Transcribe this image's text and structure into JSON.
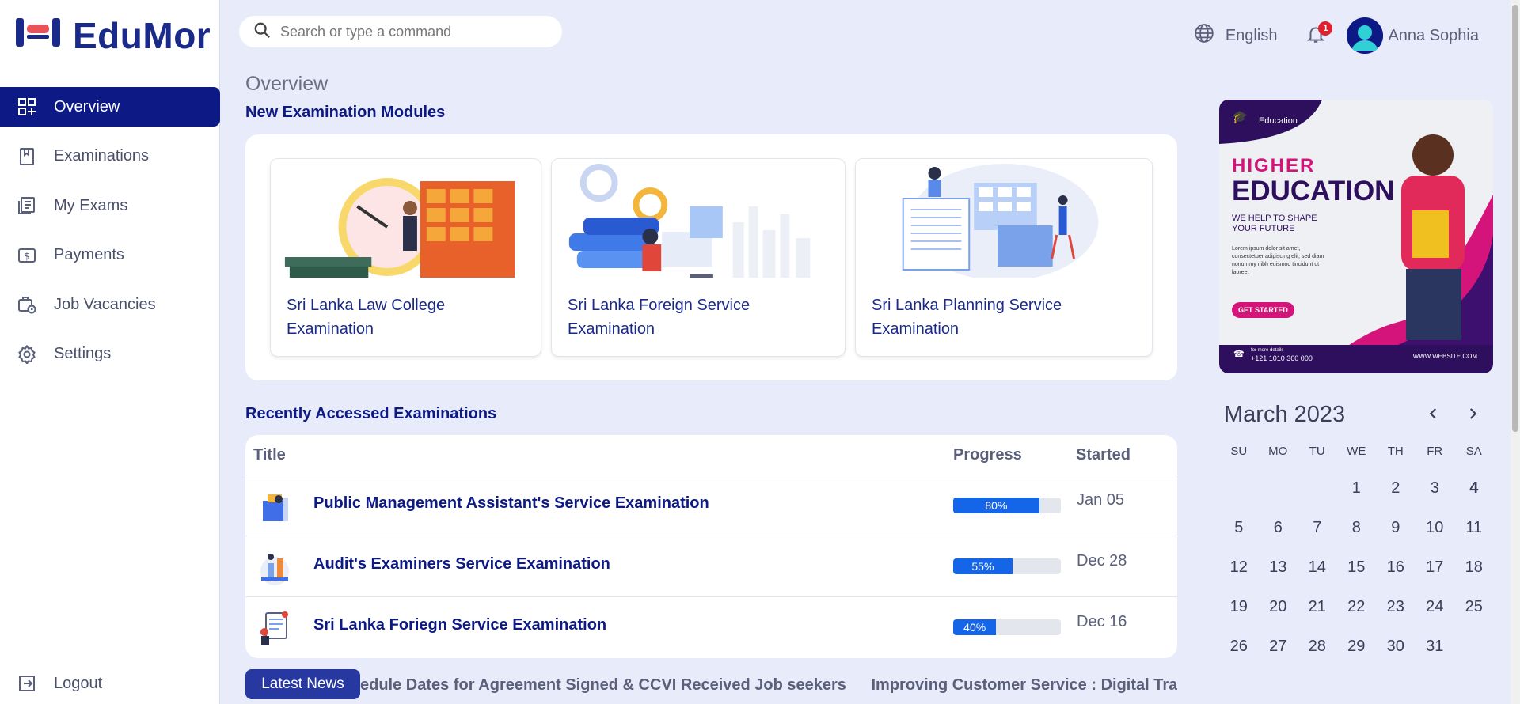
{
  "app": {
    "name": "EduMor"
  },
  "sidebar": {
    "items": [
      {
        "label": "Overview",
        "icon": "dashboard-icon",
        "active": true
      },
      {
        "label": "Examinations",
        "icon": "bookmark-book-icon"
      },
      {
        "label": "My Exams",
        "icon": "document-list-icon"
      },
      {
        "label": "Payments",
        "icon": "dollar-card-icon"
      },
      {
        "label": "Job Vacancies",
        "icon": "briefcase-clock-icon"
      },
      {
        "label": "Settings",
        "icon": "gear-icon"
      }
    ],
    "logout_label": "Logout"
  },
  "search": {
    "placeholder": "Search or type a command"
  },
  "topbar": {
    "language": "English",
    "notification_count": "1",
    "user_name": "Anna Sophia"
  },
  "main": {
    "page_title": "Overview",
    "modules_title": "New Examination Modules",
    "modules": [
      {
        "label": "Sri Lanka Law College Examination"
      },
      {
        "label": "Sri Lanka Foreign Service Examination"
      },
      {
        "label": "Sri Lanka Planning Service Examination"
      }
    ],
    "recent_title": "Recently Accessed Examinations",
    "table_headers": {
      "title": "Title",
      "progress": "Progress",
      "started": "Started"
    },
    "recent": [
      {
        "title": "Public Management Assistant's Service Examination",
        "progress": 80,
        "progress_label": "80%",
        "started": "Jan 05"
      },
      {
        "title": "Audit's Examiners Service Examination",
        "progress": 55,
        "progress_label": "55%",
        "started": "Dec 28"
      },
      {
        "title": "Sri Lanka Foriegn Service Examination",
        "progress": 40,
        "progress_label": "40%",
        "started": "Dec 16"
      }
    ],
    "news_label": "Latest News",
    "news_items": [
      "edule Dates for Agreement Signed & CCVI Received Job seekers",
      "Improving Customer Service : Digital Transforma"
    ]
  },
  "promo": {
    "brand": "Education",
    "headline_1": "HIGHER",
    "headline_2": "EDUCATION",
    "tagline": "WE HELP TO SHAPE YOUR FUTURE",
    "body": "Lorem ipsum dolor sit amet, consectetuer adipiscing elit, sed diam nonummy nibh euismod tincidunt ut laoreet",
    "cta": "GET STARTED",
    "contact_label": "for more details",
    "phone": "+121 1010 360 000",
    "website": "WWW.WEBSITE.COM"
  },
  "calendar": {
    "month_label": "March 2023",
    "weekdays": [
      "SU",
      "MO",
      "TU",
      "WE",
      "TH",
      "FR",
      "SA"
    ],
    "weeks": [
      [
        "",
        "",
        "",
        "1",
        "2",
        "3",
        "4"
      ],
      [
        "5",
        "6",
        "7",
        "8",
        "9",
        "10",
        "11"
      ],
      [
        "12",
        "13",
        "14",
        "15",
        "16",
        "17",
        "18"
      ],
      [
        "19",
        "20",
        "21",
        "22",
        "23",
        "24",
        "25"
      ],
      [
        "26",
        "27",
        "28",
        "29",
        "30",
        "31",
        ""
      ]
    ],
    "today": "4"
  },
  "colors": {
    "primary": "#0d1a86",
    "background": "#e8ebfa",
    "progress": "#1565e8",
    "news_badge": "#2738a0",
    "promo_magenta": "#d4147a"
  }
}
